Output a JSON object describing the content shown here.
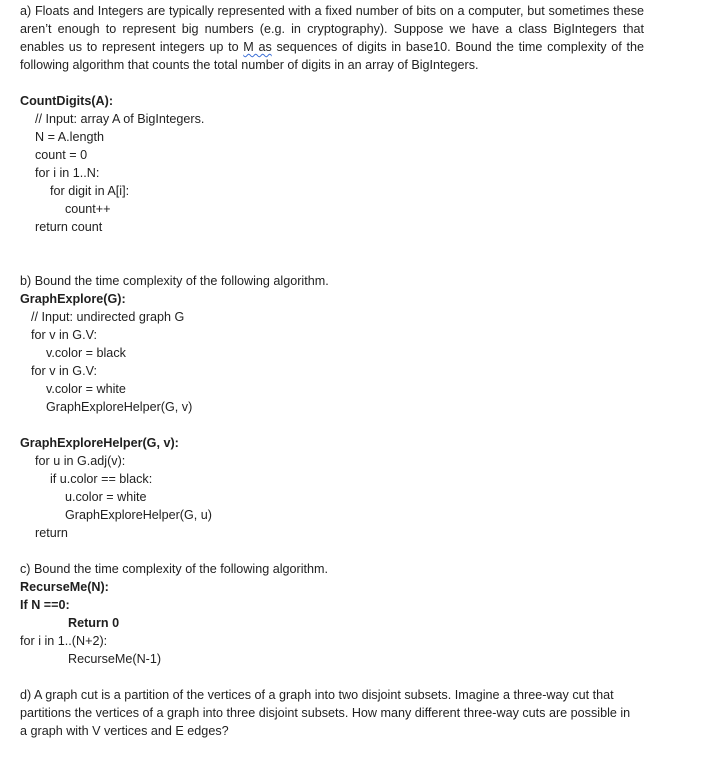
{
  "part_a": {
    "intro_before": "a) Floats and Integers are typically represented with a fixed number of bits on a computer, but sometimes these aren’t enough to represent big numbers (e.g. in cryptography). Suppose we have a class BigIntegers that enables us to represent integers up to ",
    "intro_flagged": "M as",
    "intro_after": " sequences of digits in base10. Bound the time complexity of the following algorithm that counts the total number of digits in an array of BigIntegers.",
    "code": [
      "CountDigits(A):",
      "// Input: array A of BigIntegers.",
      "N = A.length",
      "count = 0",
      "for i in 1..N:",
      "for digit in A[i]:",
      "count++",
      "return count"
    ]
  },
  "part_b": {
    "intro": "b) Bound the time complexity of the following algorithm.",
    "code": [
      "GraphExplore(G):",
      "// Input: undirected graph G",
      "for v in G.V:",
      "v.color = black",
      "for v in G.V:",
      "v.color = white",
      "GraphExploreHelper(G, v)"
    ],
    "helper": [
      "GraphExploreHelper(G, v):",
      "for u in G.adj(v):",
      "if u.color == black:",
      "u.color = white",
      "GraphExploreHelper(G, u)",
      "return"
    ]
  },
  "part_c": {
    "intro": "c) Bound the time complexity of the following algorithm.",
    "code": [
      "RecurseMe(N):",
      "If N ==0:",
      "Return 0",
      "for i in 1..(N+2):",
      "RecurseMe(N-1)"
    ]
  },
  "part_d": {
    "text": "d) A graph cut is a partition of the vertices of a graph into two disjoint subsets. Imagine a three-way cut that partitions the vertices of a graph into three disjoint subsets. How many different three-way cuts are possible in a graph with V vertices and E edges?"
  }
}
